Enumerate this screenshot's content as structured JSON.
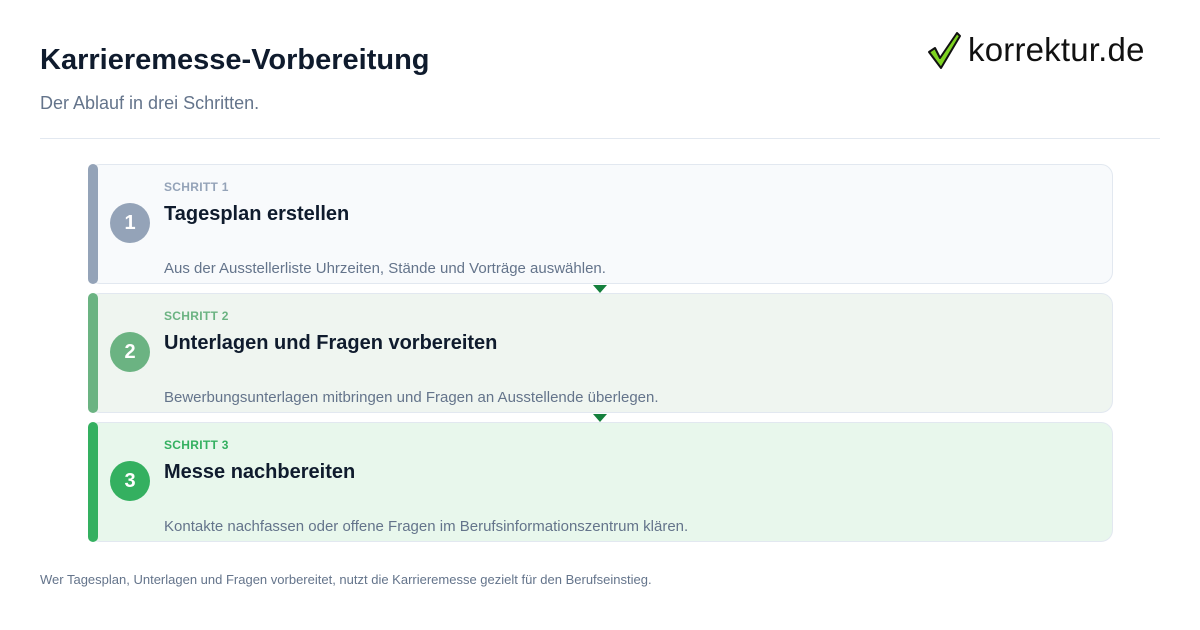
{
  "header": {
    "title": "Karrieremesse-Vorbereitung",
    "subtitle": "Der Ablauf in drei Schritten."
  },
  "logo": {
    "text": "korrektur.de",
    "icon": "checkmark-icon"
  },
  "steps": [
    {
      "number": "1",
      "label": "SCHRITT 1",
      "title": "Tagesplan erstellen",
      "description": "Aus der Ausstellerliste Uhrzeiten, Stände und Vorträge auswählen.",
      "accent_color": "#94a3b8",
      "background_color": "#f8fafc"
    },
    {
      "number": "2",
      "label": "SCHRITT 2",
      "title": "Unterlagen und Fragen vorbereiten",
      "description": "Bewerbungsunterlagen mitbringen und Fragen an Ausstellende überlegen.",
      "accent_color": "#6bb382",
      "background_color": "#eff5f0"
    },
    {
      "number": "3",
      "label": "SCHRITT 3",
      "title": "Messe nachbereiten",
      "description": "Kontakte nachfassen oder offene Fragen im Berufsinformationszentrum klären.",
      "accent_color": "#34b060",
      "background_color": "#e8f7ec"
    }
  ],
  "colors": {
    "arrow": "#15803d",
    "title": "#0f1b2d",
    "muted_text": "#64748b"
  },
  "footer": {
    "text": "Wer Tagesplan, Unterlagen und Fragen vorbereitet, nutzt die Karrieremesse gezielt für den Berufseinstieg."
  }
}
